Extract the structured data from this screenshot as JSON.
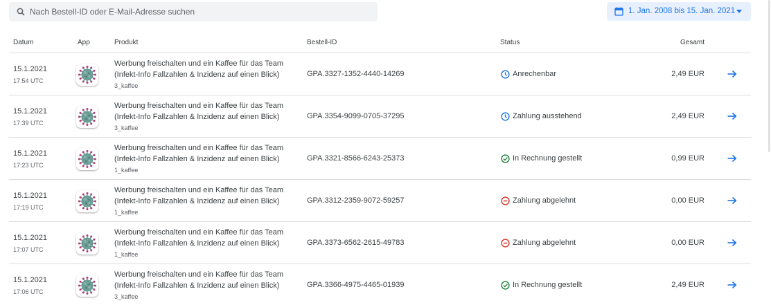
{
  "search": {
    "placeholder": "Nach Bestell-ID oder E-Mail-Adresse suchen"
  },
  "date_range": {
    "label": "1. Jan. 2008 bis 15. Jan. 2021"
  },
  "columns": {
    "date": "Datum",
    "app": "App",
    "product": "Produkt",
    "order_id": "Bestell-ID",
    "status": "Status",
    "total": "Gesamt"
  },
  "colors": {
    "accent": "#1a73e8",
    "success": "#188038",
    "error": "#d93025",
    "pending": "#1a73e8"
  },
  "rows": [
    {
      "date": "15.1.2021",
      "time": "17:54 UTC",
      "product_line1": "Werbung freischalten und ein Kaffee für das Team",
      "product_line2": "(Infekt-Info Fallzahlen & Inzidenz auf einen Blick)",
      "sku": "3_kaffee",
      "order_id": "GPA.3327-1352-4440-14269",
      "status": "Anrechenbar",
      "status_icon": "clock-icon",
      "total": "2,49 EUR"
    },
    {
      "date": "15.1.2021",
      "time": "17:39 UTC",
      "product_line1": "Werbung freischalten und ein Kaffee für das Team",
      "product_line2": "(Infekt-Info Fallzahlen & Inzidenz auf einen Blick)",
      "sku": "3_kaffee",
      "order_id": "GPA.3354-9099-0705-37295",
      "status": "Zahlung ausstehend",
      "status_icon": "clock-icon",
      "total": "2,49 EUR"
    },
    {
      "date": "15.1.2021",
      "time": "17:23 UTC",
      "product_line1": "Werbung freischalten und ein Kaffee für das Team",
      "product_line2": "(Infekt-Info Fallzahlen & Inzidenz auf einen Blick)",
      "sku": "1_kaffee",
      "order_id": "GPA.3321-8566-6243-25373",
      "status": "In Rechnung gestellt",
      "status_icon": "check-circle-icon",
      "total": "0,99 EUR"
    },
    {
      "date": "15.1.2021",
      "time": "17:19 UTC",
      "product_line1": "Werbung freischalten und ein Kaffee für das Team",
      "product_line2": "(Infekt-Info Fallzahlen & Inzidenz auf einen Blick)",
      "sku": "1_kaffee",
      "order_id": "GPA.3312-2359-9072-59257",
      "status": "Zahlung abgelehnt",
      "status_icon": "minus-circle-icon",
      "total": "0,00 EUR"
    },
    {
      "date": "15.1.2021",
      "time": "17:07 UTC",
      "product_line1": "Werbung freischalten und ein Kaffee für das Team",
      "product_line2": "(Infekt-Info Fallzahlen & Inzidenz auf einen Blick)",
      "sku": "1_kaffee",
      "order_id": "GPA.3373-6562-2615-49783",
      "status": "Zahlung abgelehnt",
      "status_icon": "minus-circle-icon",
      "total": "0,00 EUR"
    },
    {
      "date": "15.1.2021",
      "time": "17:06 UTC",
      "product_line1": "Werbung freischalten und ein Kaffee für das Team",
      "product_line2": "(Infekt-Info Fallzahlen & Inzidenz auf einen Blick)",
      "sku": "3_kaffee",
      "order_id": "GPA.3366-4975-4465-01939",
      "status": "In Rechnung gestellt",
      "status_icon": "check-circle-icon",
      "total": "2,49 EUR"
    }
  ]
}
